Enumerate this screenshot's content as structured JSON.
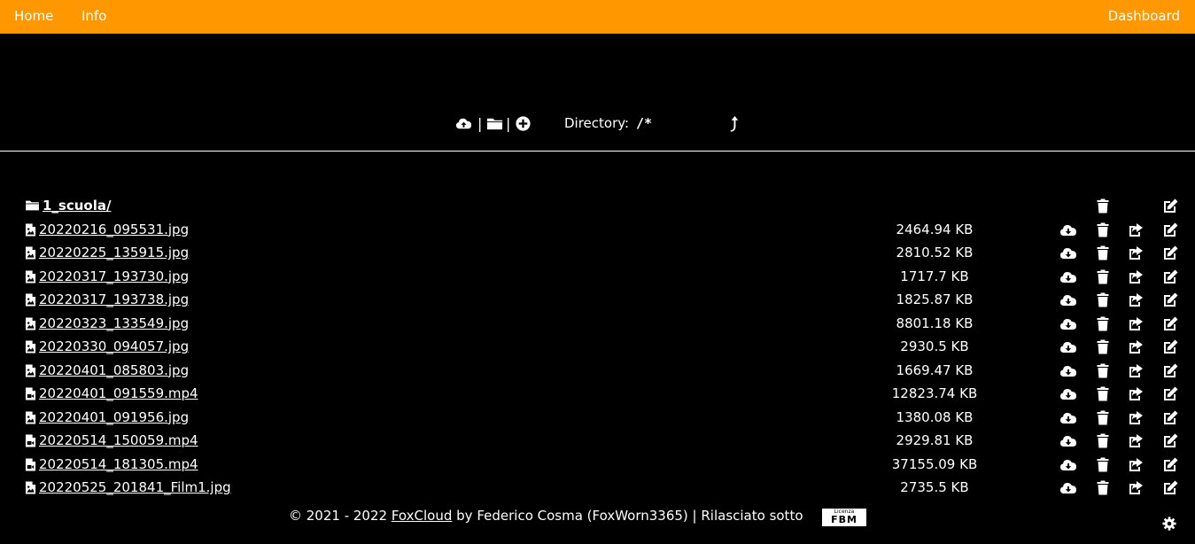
{
  "nav": {
    "home_label": "Home",
    "info_label": "Info",
    "dashboard_label": "Dashboard",
    "bar_color": "#ff9800"
  },
  "toolbar": {
    "upload_icon": "cloud-upload-icon",
    "new_folder_icon": "folder-icon",
    "add_icon": "plus-circle-icon",
    "separator": "|",
    "directory_label": "Directory:",
    "directory_value": "/*",
    "up_icon": "level-up-icon"
  },
  "files": [
    {
      "name": "1_scuola/",
      "size": "",
      "type": "folder"
    },
    {
      "name": "20220216_095531.jpg",
      "size": "2464.94 KB",
      "type": "image"
    },
    {
      "name": "20220225_135915.jpg",
      "size": "2810.52 KB",
      "type": "image"
    },
    {
      "name": "20220317_193730.jpg",
      "size": "1717.7 KB",
      "type": "image"
    },
    {
      "name": "20220317_193738.jpg",
      "size": "1825.87 KB",
      "type": "image"
    },
    {
      "name": "20220323_133549.jpg",
      "size": "8801.18 KB",
      "type": "image"
    },
    {
      "name": "20220330_094057.jpg",
      "size": "2930.5 KB",
      "type": "image"
    },
    {
      "name": "20220401_085803.jpg",
      "size": "1669.47 KB",
      "type": "image"
    },
    {
      "name": "20220401_091559.mp4",
      "size": "12823.74 KB",
      "type": "video"
    },
    {
      "name": "20220401_091956.jpg",
      "size": "1380.08 KB",
      "type": "image"
    },
    {
      "name": "20220514_150059.mp4",
      "size": "2929.81 KB",
      "type": "video"
    },
    {
      "name": "20220514_181305.mp4",
      "size": "37155.09 KB",
      "type": "video"
    },
    {
      "name": "20220525_201841_Film1.jpg",
      "size": "2735.5 KB",
      "type": "image"
    }
  ],
  "row_actions": {
    "download_icon": "cloud-download-icon",
    "delete_icon": "trash-icon",
    "share_icon": "share-icon",
    "edit_icon": "edit-icon"
  },
  "footer": {
    "prefix": "© 2021 - 2022 ",
    "link_label": "FoxCloud",
    "suffix": " by Federico Cosma (FoxWorn3365) | Rilasciato sotto",
    "badge_small": "Licenza",
    "badge_big": "FBM",
    "settings_icon": "gear-icon"
  }
}
